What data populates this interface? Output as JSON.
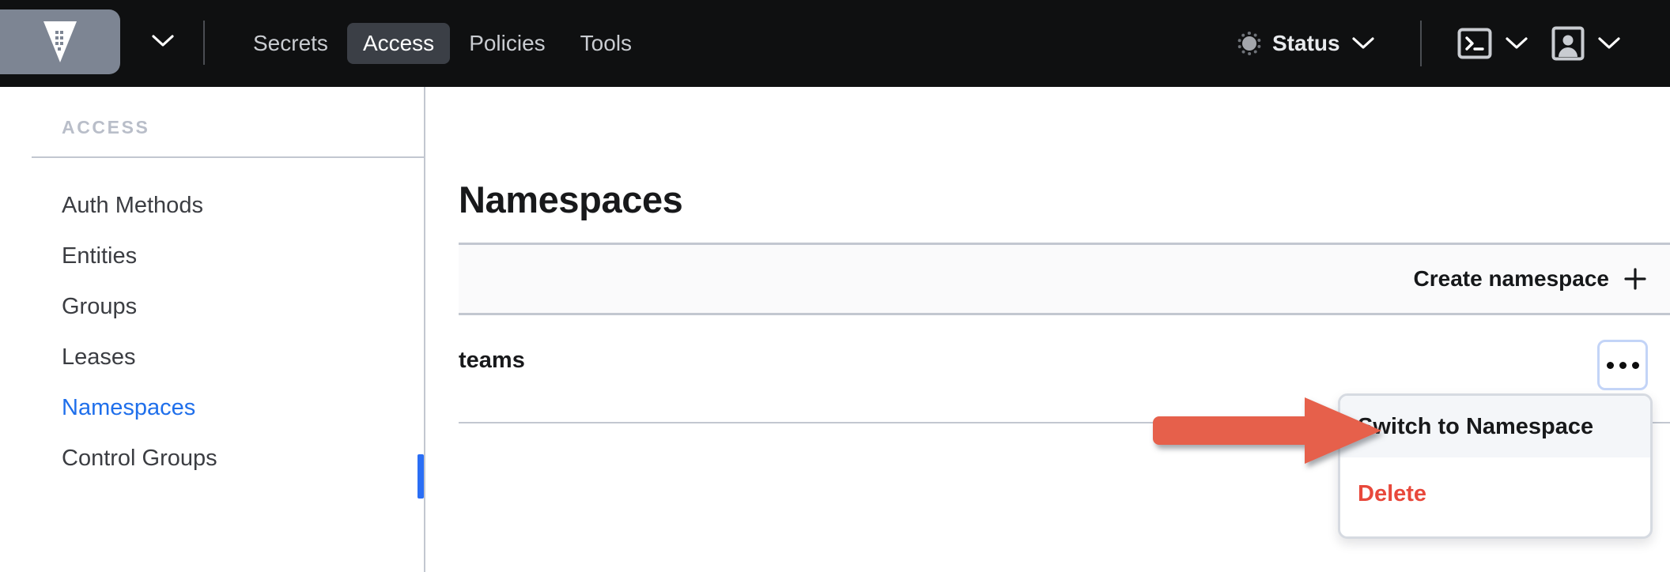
{
  "topnav": {
    "logo_icon": "vault-logo-icon",
    "logo_caret_icon": "chevron-down-icon",
    "tabs": [
      {
        "label": "Secrets",
        "active": false
      },
      {
        "label": "Access",
        "active": true
      },
      {
        "label": "Policies",
        "active": false
      },
      {
        "label": "Tools",
        "active": false
      }
    ],
    "status": {
      "label": "Status",
      "icon": "status-dot-icon",
      "caret_icon": "chevron-down-icon",
      "dot_color": "#a3a6ab"
    },
    "console_icon": "terminal-icon",
    "console_caret_icon": "chevron-down-icon",
    "user_icon": "user-avatar-icon",
    "user_caret_icon": "chevron-down-icon",
    "background_color": "#0f1011",
    "active_tab_color": "#3b3f46"
  },
  "sidebar": {
    "heading": "ACCESS",
    "items": [
      {
        "label": "Auth Methods",
        "active": false
      },
      {
        "label": "Entities",
        "active": false
      },
      {
        "label": "Groups",
        "active": false
      },
      {
        "label": "Leases",
        "active": false
      },
      {
        "label": "Namespaces",
        "active": true
      },
      {
        "label": "Control Groups",
        "active": false
      }
    ],
    "active_color": "#1f6feb",
    "active_indicator_color": "#2a6ef5"
  },
  "main": {
    "page_title": "Namespaces",
    "toolbar": {
      "create_label": "Create namespace",
      "plus_icon": "plus-icon"
    },
    "rows": [
      {
        "label": "teams",
        "more_icon": "ellipsis-icon"
      }
    ]
  },
  "menu": {
    "items": [
      {
        "label": "Switch to Namespace",
        "style": "default",
        "highlighted": true
      },
      {
        "label": "Delete",
        "style": "danger",
        "highlighted": false
      }
    ],
    "danger_color": "#e8483b",
    "highlight_color": "#f4f6f9"
  },
  "annotation": {
    "type": "arrow",
    "direction": "right",
    "color": "#e6604c",
    "points_to": "Switch to Namespace"
  }
}
